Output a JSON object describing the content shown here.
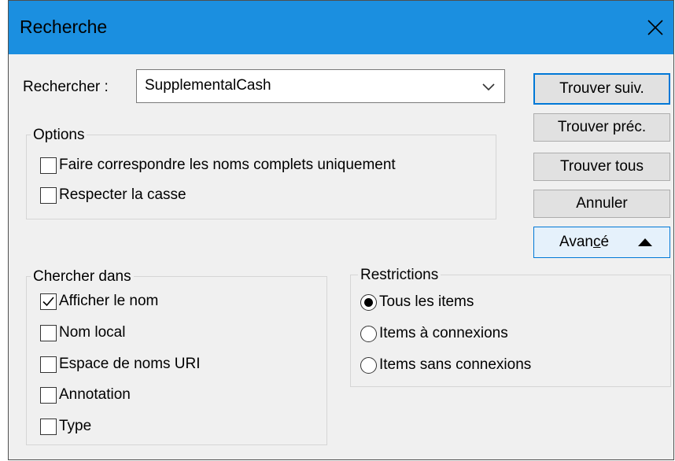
{
  "window": {
    "title": "Recherche"
  },
  "search": {
    "label": "Rechercher :",
    "value": "SupplementalCash"
  },
  "buttons": {
    "find_next": "Trouver suiv.",
    "find_prev": "Trouver préc.",
    "find_all": "Trouver tous",
    "cancel": "Annuler",
    "advanced_pre": "Avan",
    "advanced_u": "c",
    "advanced_post": "é"
  },
  "options": {
    "title": "Options",
    "match_full_names": {
      "label": "Faire correspondre les noms complets uniquement",
      "checked": false
    },
    "match_case": {
      "label": "Respecter la casse",
      "checked": false
    }
  },
  "search_in": {
    "title": "Chercher dans",
    "items": [
      {
        "label": "Afficher le nom",
        "checked": true
      },
      {
        "label": "Nom local",
        "checked": false
      },
      {
        "label": "Espace de noms URI",
        "checked": false
      },
      {
        "label": "Annotation",
        "checked": false
      },
      {
        "label": "Type",
        "checked": false
      }
    ]
  },
  "restrictions": {
    "title": "Restrictions",
    "items": [
      {
        "label": "Tous les items",
        "selected": true
      },
      {
        "label": "Items à connexions",
        "selected": false
      },
      {
        "label": "Items sans connexions",
        "selected": false
      }
    ]
  },
  "icons": {
    "close": "close-icon",
    "dropdown": "chevron-down-icon",
    "advanced_toggle": "triangle-up-icon",
    "check": "check-icon"
  }
}
